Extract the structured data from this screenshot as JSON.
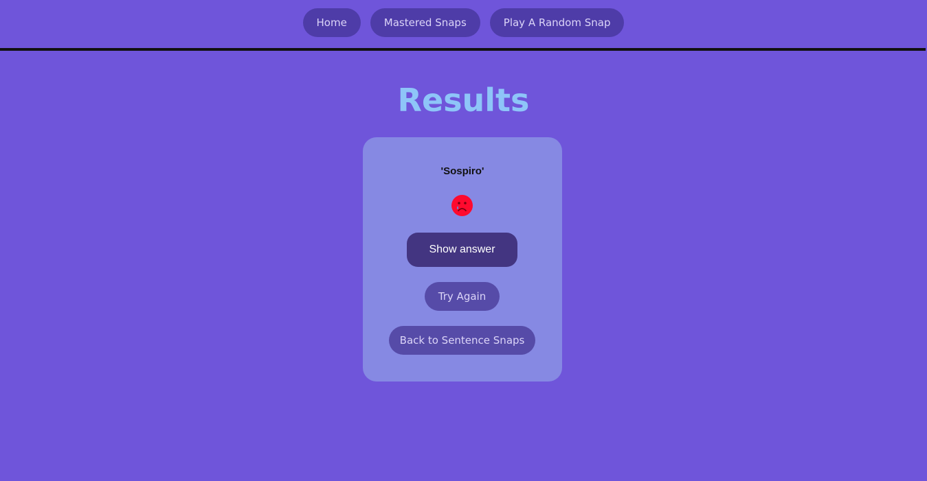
{
  "nav": {
    "items": [
      {
        "label": "Home"
      },
      {
        "label": "Mastered Snaps"
      },
      {
        "label": "Play A Random Snap"
      }
    ]
  },
  "page": {
    "title": "Results"
  },
  "card": {
    "word": "'Sospiro'",
    "result_icon": "sad-face-icon",
    "show_answer_label": "Show answer",
    "try_again_label": "Try Again",
    "back_label": "Back to Sentence Snaps"
  },
  "colors": {
    "background": "#6f55da",
    "title": "#8ec5f8",
    "card": "#8689e3",
    "primary_button": "#433581",
    "sad_face": "#ff0a2e"
  }
}
